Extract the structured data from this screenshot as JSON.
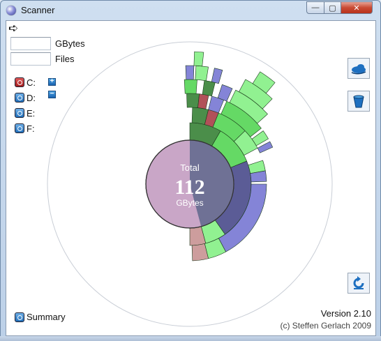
{
  "window": {
    "title": "Scanner",
    "minimize_glyph": "—",
    "maximize_glyph": "▢",
    "close_glyph": "✕"
  },
  "toolbar": {
    "back_glyph": "➪"
  },
  "stats": {
    "gbytes_label": "GBytes",
    "gbytes_value": "",
    "files_label": "Files",
    "files_value": ""
  },
  "drives": [
    {
      "label": "C:",
      "color": "#c0262b"
    },
    {
      "label": "D:",
      "color": "#1f6db8"
    },
    {
      "label": "E:",
      "color": "#1f6db8"
    },
    {
      "label": "F:",
      "color": "#1f6db8"
    }
  ],
  "expand_buttons": {
    "plus": "+",
    "minus": "−"
  },
  "center": {
    "line1": "Total",
    "value": "112",
    "unit": "GBytes"
  },
  "summary_label": "Summary",
  "version": "Version 2.10",
  "copyright": "(c) Steffen Gerlach 2009",
  "colors": {
    "center_fill": "#c9a6c7",
    "center_overlay": "#6f7195",
    "dark_green": "#2c7a2a",
    "green": "#4ad24a",
    "light_green": "#7eef7e",
    "navy": "#3e3f84",
    "blue_purple": "#6f6fd0",
    "maroon": "#a3323c",
    "rose": "#c48c8c"
  }
}
